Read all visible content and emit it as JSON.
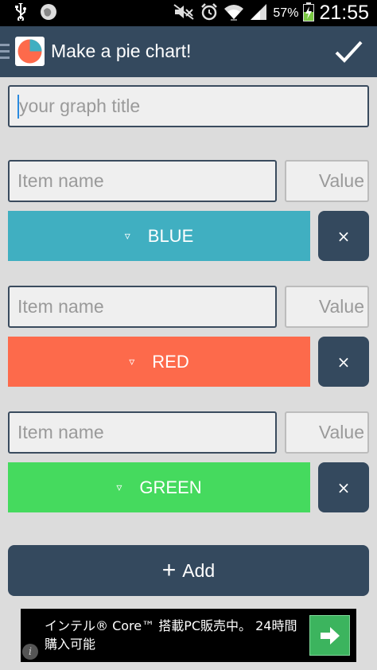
{
  "status_bar": {
    "battery_percent": "57%",
    "time": "21:55",
    "left_icons": [
      "usb-icon",
      "notification-icon"
    ],
    "right_icons": [
      "mute-icon",
      "alarm-icon",
      "wifi-icon",
      "signal-icon",
      "battery-charging-icon"
    ]
  },
  "app_bar": {
    "title": "Make a pie chart!",
    "confirm_icon": "checkmark-icon"
  },
  "title_input": {
    "placeholder": "your graph title",
    "value": ""
  },
  "items": [
    {
      "name_placeholder": "Item name",
      "value_placeholder": "Value",
      "color_label": "BLUE",
      "color": "#40afc1",
      "delete_label": "×"
    },
    {
      "name_placeholder": "Item name",
      "value_placeholder": "Value",
      "color_label": "RED",
      "color": "#fd6a4b",
      "delete_label": "×"
    },
    {
      "name_placeholder": "Item name",
      "value_placeholder": "Value",
      "color_label": "GREEN",
      "color": "#45da5e",
      "delete_label": "×"
    }
  ],
  "dropdown_glyph": "▿",
  "add_button": {
    "plus": "+",
    "label": "Add"
  },
  "ad": {
    "text": "インテル® Core™ 搭載PC販売中。 24時間購入可能",
    "info": "i"
  },
  "colors": {
    "app_bar": "#34495e",
    "background": "#dcdcdc",
    "ad_button": "#3cb45e"
  }
}
